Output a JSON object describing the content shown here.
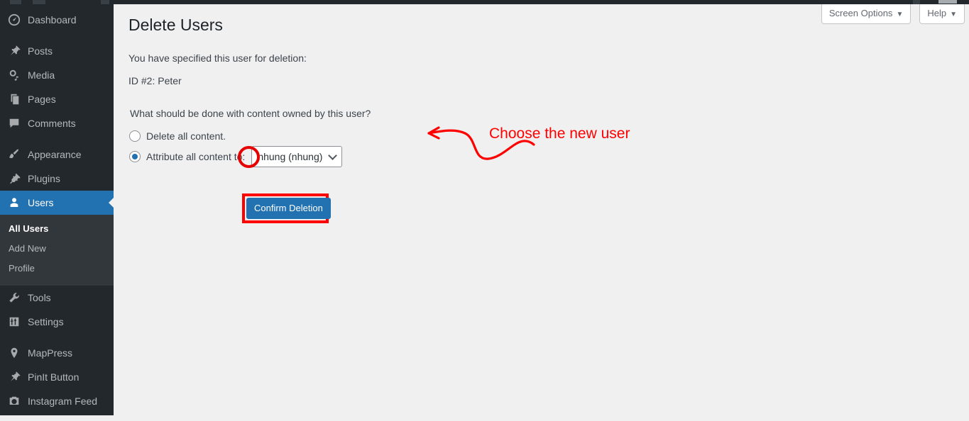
{
  "colors": {
    "sidebar_bg": "#23282d",
    "submenu_bg": "#32373c",
    "accent_blue": "#2271b1",
    "content_bg": "#f0f0f1",
    "annotation_red": "#ff0000",
    "ring_red": "#e60000"
  },
  "sidebar": {
    "items": [
      {
        "label": "Dashboard",
        "icon": "dashboard-icon",
        "active": false
      },
      {
        "label": "Posts",
        "icon": "pin-icon",
        "active": false
      },
      {
        "label": "Media",
        "icon": "media-icon",
        "active": false
      },
      {
        "label": "Pages",
        "icon": "pages-icon",
        "active": false
      },
      {
        "label": "Comments",
        "icon": "comment-icon",
        "active": false
      },
      {
        "label": "Appearance",
        "icon": "brush-icon",
        "active": false
      },
      {
        "label": "Plugins",
        "icon": "plug-icon",
        "active": false
      },
      {
        "label": "Users",
        "icon": "user-icon",
        "active": true
      },
      {
        "label": "Tools",
        "icon": "wrench-icon",
        "active": false
      },
      {
        "label": "Settings",
        "icon": "sliders-icon",
        "active": false
      },
      {
        "label": "MapPress",
        "icon": "map-pin-icon",
        "active": false
      },
      {
        "label": "PinIt Button",
        "icon": "pin-icon",
        "active": false
      },
      {
        "label": "Instagram Feed",
        "icon": "camera-icon",
        "active": false
      }
    ],
    "submenu": [
      {
        "label": "All Users",
        "current": true
      },
      {
        "label": "Add New",
        "current": false
      },
      {
        "label": "Profile",
        "current": false
      }
    ]
  },
  "screen_meta": {
    "screen_options_label": "Screen Options",
    "help_label": "Help",
    "caret": "▼"
  },
  "main": {
    "page_title": "Delete Users",
    "intro": "You have specified this user for deletion:",
    "user_line": "ID #2: Peter",
    "question": "What should be done with content owned by this user?",
    "option_delete": "Delete all content.",
    "option_attribute": "Attribute all content to:",
    "selected_radio": "attribute",
    "user_select": {
      "value": "nhung (nhung)",
      "options": [
        "nhung (nhung)"
      ]
    },
    "submit_label": "Confirm Deletion"
  },
  "annotation": {
    "text": "Choose the new user"
  }
}
